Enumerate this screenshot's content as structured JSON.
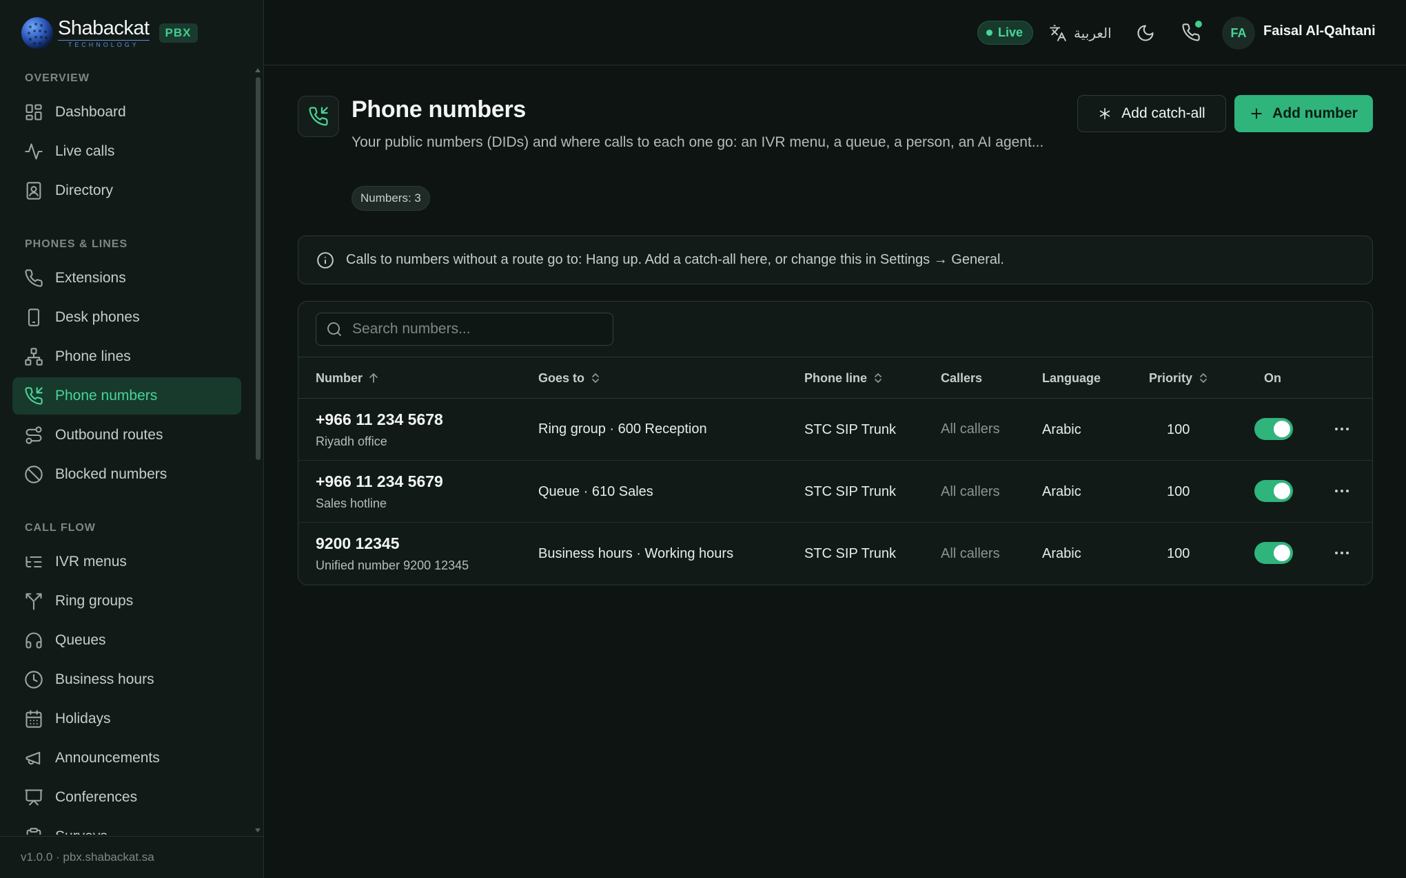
{
  "brand": {
    "name": "Shabackat",
    "sub": "TECHNOLOGY",
    "badge": "PBX"
  },
  "sidebar": {
    "sections": [
      {
        "title": "OVERVIEW",
        "items": [
          {
            "label": "Dashboard",
            "icon": "dashboard-icon"
          },
          {
            "label": "Live calls",
            "icon": "activity-icon"
          },
          {
            "label": "Directory",
            "icon": "contact-book-icon"
          }
        ]
      },
      {
        "title": "PHONES & LINES",
        "items": [
          {
            "label": "Extensions",
            "icon": "phone-icon"
          },
          {
            "label": "Desk phones",
            "icon": "smartphone-icon"
          },
          {
            "label": "Phone lines",
            "icon": "network-icon"
          },
          {
            "label": "Phone numbers",
            "icon": "phone-incoming-icon",
            "active": true
          },
          {
            "label": "Outbound routes",
            "icon": "route-icon"
          },
          {
            "label": "Blocked numbers",
            "icon": "ban-icon"
          }
        ]
      },
      {
        "title": "CALL FLOW",
        "items": [
          {
            "label": "IVR menus",
            "icon": "list-tree-icon"
          },
          {
            "label": "Ring groups",
            "icon": "split-icon"
          },
          {
            "label": "Queues",
            "icon": "headphones-icon"
          },
          {
            "label": "Business hours",
            "icon": "clock-icon"
          },
          {
            "label": "Holidays",
            "icon": "calendar-icon"
          },
          {
            "label": "Announcements",
            "icon": "megaphone-icon"
          },
          {
            "label": "Conferences",
            "icon": "presentation-icon"
          },
          {
            "label": "Surveys",
            "icon": "clipboard-check-icon"
          }
        ]
      }
    ],
    "footer": "v1.0.0 · pbx.shabackat.sa"
  },
  "topbar": {
    "status": "Live",
    "language": "العربية",
    "user_initials": "FA",
    "user_name": "Faisal Al-Qahtani"
  },
  "page": {
    "title": "Phone numbers",
    "description": "Your public numbers (DIDs) and where calls to each one go: an IVR menu, a queue, a person, an AI agent...",
    "count": "Numbers: 3",
    "catchall_label": "Add catch-all",
    "add_label": "Add number"
  },
  "notice": "Calls to numbers without a route go to: Hang up. Add a catch-all here, or change this in Settings → General.",
  "search": {
    "placeholder": "Search numbers..."
  },
  "table": {
    "columns": [
      "Number",
      "Goes to",
      "Phone line",
      "Callers",
      "Language",
      "Priority",
      "On"
    ],
    "rows": [
      {
        "number": "+966 11 234 5678",
        "label": "Riyadh office",
        "goes_to": "Ring group · 600 Reception",
        "line": "STC SIP Trunk",
        "callers": "All callers",
        "language": "Arabic",
        "priority": "100",
        "on": true
      },
      {
        "number": "+966 11 234 5679",
        "label": "Sales hotline",
        "goes_to": "Queue · 610 Sales",
        "line": "STC SIP Trunk",
        "callers": "All callers",
        "language": "Arabic",
        "priority": "100",
        "on": true
      },
      {
        "number": "9200 12345",
        "label": "Unified number 9200 12345",
        "goes_to": "Business hours · Working hours",
        "line": "STC SIP Trunk",
        "callers": "All callers",
        "language": "Arabic",
        "priority": "100",
        "on": true
      }
    ]
  },
  "colors": {
    "accent": "#2fb47c",
    "accent_text": "#48d597",
    "background": "#0d1412",
    "sidebar": "#111a17"
  }
}
